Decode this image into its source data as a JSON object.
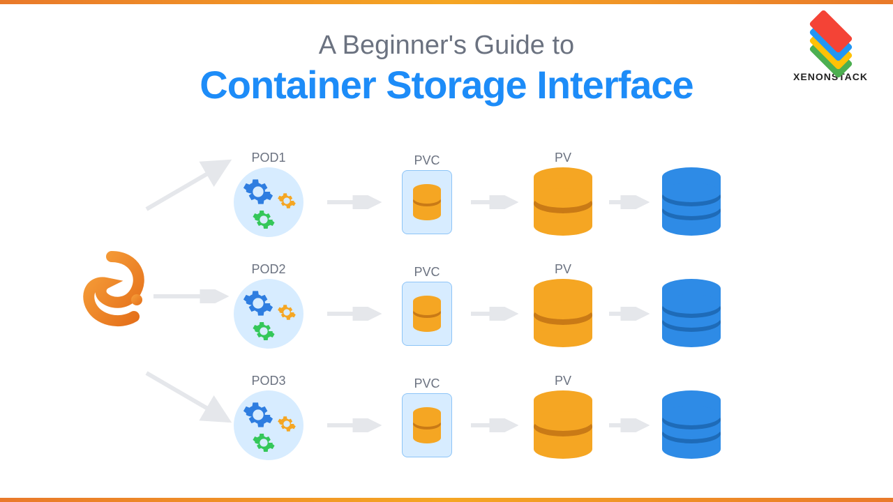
{
  "brand": "XENONSTACK",
  "title": {
    "subtitle": "A Beginner's Guide to",
    "main": "Container Storage Interface"
  },
  "columns": {
    "pod": [
      "POD1",
      "POD2",
      "POD3"
    ],
    "pvc": "PVC",
    "pv": "PV"
  },
  "colors": {
    "accent_blue": "#1d8cf8",
    "orange": "#f5a623",
    "dark_orange": "#c97a16",
    "cyl_blue": "#2e8be6",
    "cyl_blue_dark": "#1e6bb8",
    "arrow": "#e5e7eb",
    "pod_bg": "#d7ecff"
  },
  "diagram": {
    "rows": 3,
    "flow": [
      "origin",
      "pod",
      "pvc",
      "pv",
      "external-storage"
    ]
  }
}
